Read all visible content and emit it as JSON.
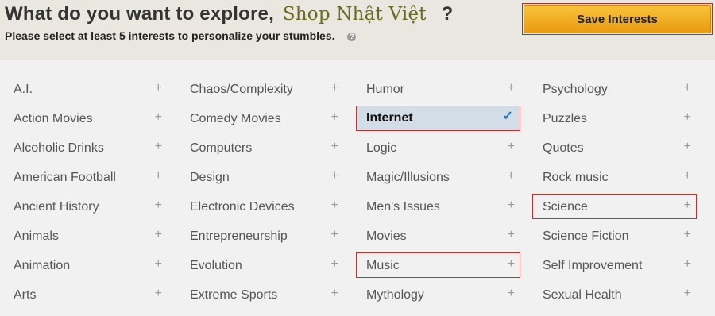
{
  "header": {
    "title": "What do you want to explore,",
    "brand": "Shop Nhật Việt",
    "question_mark": "?",
    "subtitle": "Please select at least 5 interests to personalize your stumbles.",
    "help_glyph": "?",
    "save_label": "Save Interests"
  },
  "icons": {
    "add": "+",
    "check": "✓"
  },
  "columns": [
    [
      "A.I.",
      "Action Movies",
      "Alcoholic Drinks",
      "American Football",
      "Ancient History",
      "Animals",
      "Animation",
      "Arts"
    ],
    [
      "Chaos/Complexity",
      "Comedy Movies",
      "Computers",
      "Design",
      "Electronic Devices",
      "Entrepreneurship",
      "Evolution",
      "Extreme Sports"
    ],
    [
      "Humor",
      "Internet",
      "Logic",
      "Magic/Illusions",
      "Men's Issues",
      "Movies",
      "Music",
      "Mythology"
    ],
    [
      "Psychology",
      "Puzzles",
      "Quotes",
      "Rock music",
      "Science",
      "Science Fiction",
      "Self Improvement",
      "Sexual Health"
    ]
  ],
  "selected": [
    "Internet"
  ],
  "highlighted": [
    "Music",
    "Science"
  ]
}
